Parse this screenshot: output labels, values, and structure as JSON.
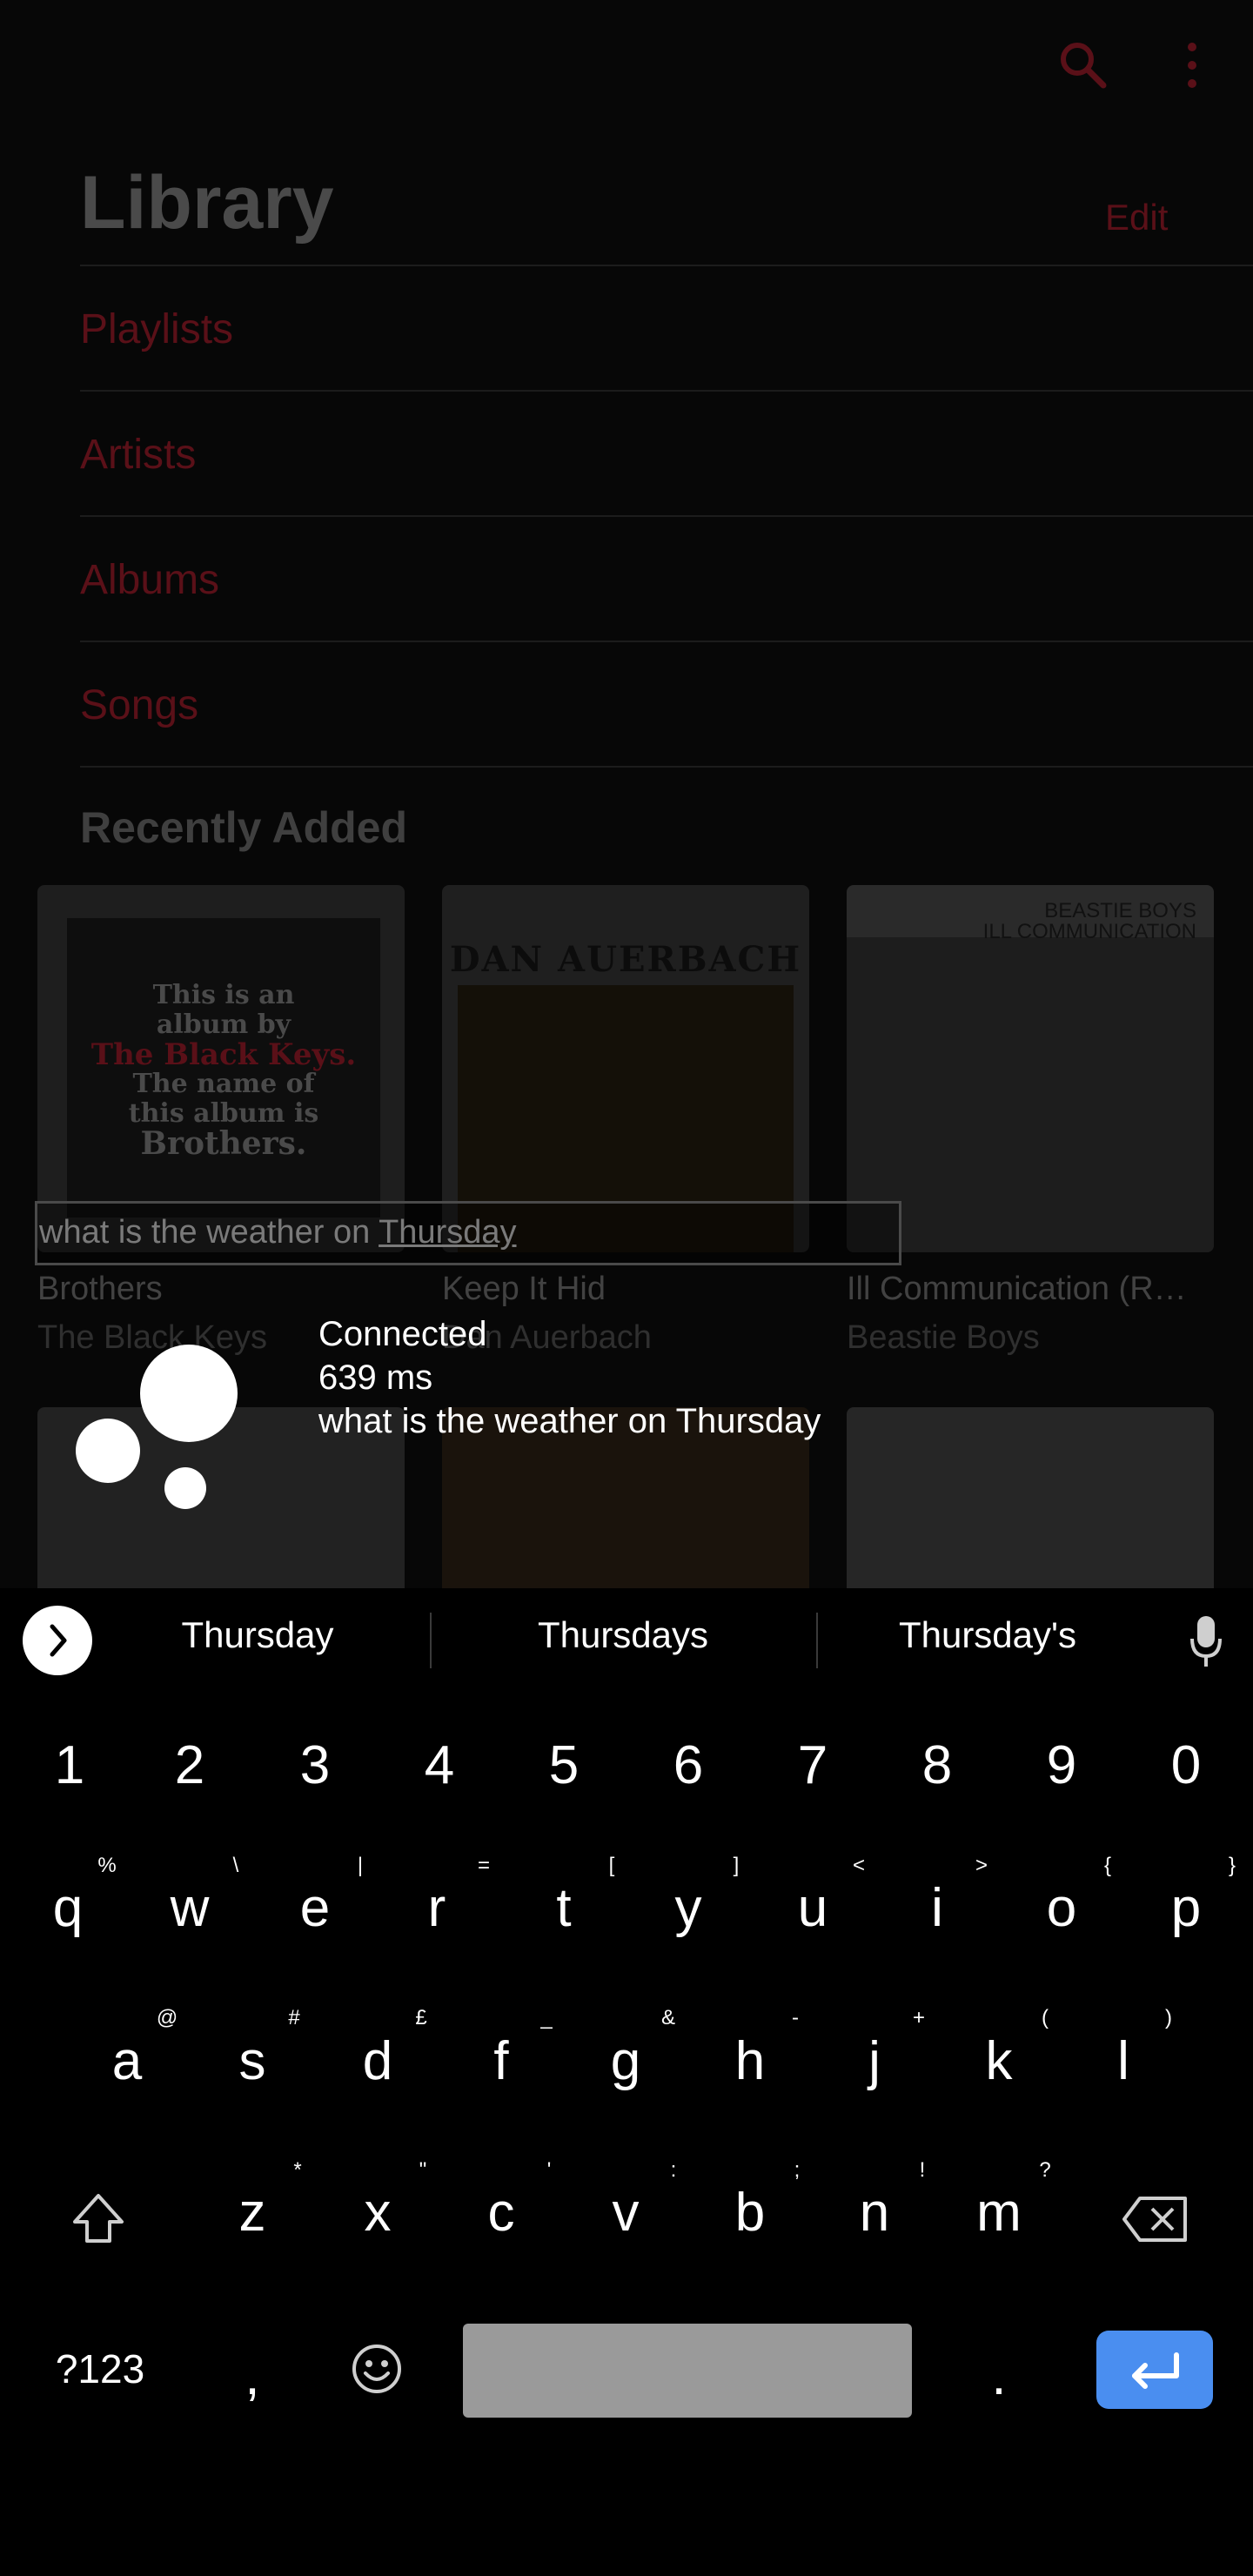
{
  "library": {
    "title": "Library",
    "edit_label": "Edit",
    "items": [
      "Playlists",
      "Artists",
      "Albums",
      "Songs"
    ],
    "recently_added_title": "Recently Added",
    "albums": [
      {
        "title": "Brothers",
        "artist": "The Black Keys"
      },
      {
        "title": "Keep It Hid",
        "artist": "Dan Auerbach"
      },
      {
        "title": "Ill Communication (R…",
        "artist": "Beastie Boys"
      }
    ],
    "covers": {
      "black_keys_lines": [
        "This is an",
        "album by",
        "The Black Keys.",
        "The name of",
        "this album is",
        "Brothers."
      ],
      "dan_auerbach": "DAN AUERBACH",
      "beastie_header_1": "BEASTIE BOYS",
      "beastie_header_2": "ILL COMMUNICATION"
    }
  },
  "voice": {
    "transcript_prefix": "what is the weather on ",
    "transcript_highlight": "Thursday",
    "status": "Connected",
    "latency": "639 ms",
    "recognized": "what is the weather on Thursday"
  },
  "keyboard": {
    "suggestions": [
      "Thursday",
      "Thursdays",
      "Thursday's"
    ],
    "numbers": [
      "1",
      "2",
      "3",
      "4",
      "5",
      "6",
      "7",
      "8",
      "9",
      "0"
    ],
    "row1": [
      "q",
      "w",
      "e",
      "r",
      "t",
      "y",
      "u",
      "i",
      "o",
      "p"
    ],
    "row1_hints": [
      "%",
      "\\",
      "|",
      "=",
      "[",
      "]",
      "<",
      ">",
      "{",
      "}"
    ],
    "row2": [
      "a",
      "s",
      "d",
      "f",
      "g",
      "h",
      "j",
      "k",
      "l"
    ],
    "row2_hints": [
      "@",
      "#",
      "£",
      "_",
      "&",
      "-",
      "+",
      "(",
      ")"
    ],
    "row3": [
      "z",
      "x",
      "c",
      "v",
      "b",
      "n",
      "m"
    ],
    "row3_hints": [
      "*",
      "\"",
      "'",
      ":",
      ";",
      "!",
      "?"
    ],
    "symbols_label": "?123",
    "comma": ",",
    "period": "."
  },
  "colors": {
    "accent_dim": "#5a1018",
    "enter_key": "#4a8ef0",
    "spacebar": "#9a9a9a"
  }
}
